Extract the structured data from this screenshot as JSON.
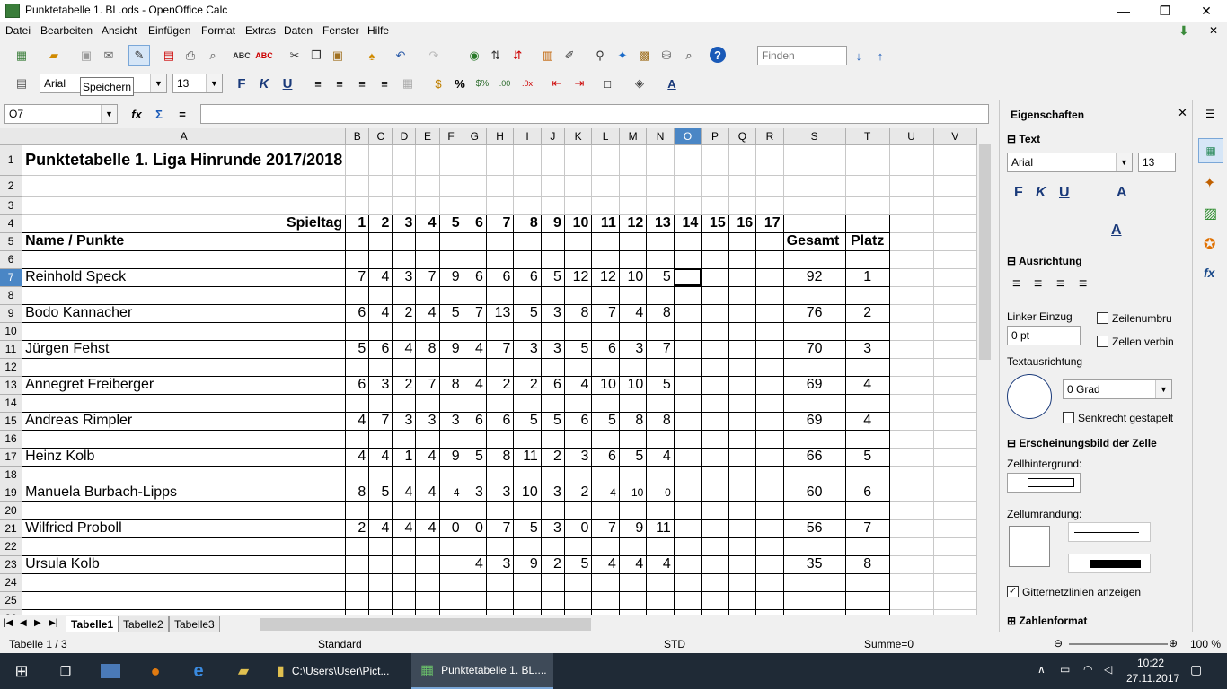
{
  "titlebar": {
    "title": "Punktetabelle 1. BL.ods - OpenOffice Calc",
    "minimize": "—",
    "restore": "❐",
    "close": "✕"
  },
  "menu": [
    "Datei",
    "Bearbeiten",
    "Ansicht",
    "Einfügen",
    "Format",
    "Extras",
    "Daten",
    "Fenster",
    "Hilfe"
  ],
  "toolbar": {
    "find_placeholder": "Finden",
    "font_name": "Arial",
    "font_size": "13",
    "tooltip": "Speichern"
  },
  "formula": {
    "cell_ref": "O7",
    "content": ""
  },
  "columns": [
    "A",
    "B",
    "C",
    "D",
    "E",
    "F",
    "G",
    "H",
    "I",
    "J",
    "K",
    "L",
    "M",
    "N",
    "O",
    "P",
    "Q",
    "R",
    "S",
    "T",
    "U",
    "V"
  ],
  "selected_column": "O",
  "selected_row": "7",
  "sheet": {
    "title": "Punktetabelle 1. Liga Hinrunde 2017/2018",
    "spieltag_label": "Spieltag",
    "spieltage": [
      "1",
      "2",
      "3",
      "4",
      "5",
      "6",
      "7",
      "8",
      "9",
      "10",
      "11",
      "12",
      "13",
      "14",
      "15",
      "16",
      "17"
    ],
    "name_header": "Name / Punkte",
    "gesamt_header": "Gesamt",
    "platz_header": "Platz",
    "players": [
      {
        "row": "7",
        "name": "Reinhold Speck",
        "scores": [
          "7",
          "4",
          "3",
          "7",
          "9",
          "6",
          "6",
          "6",
          "5",
          "12",
          "12",
          "10",
          "5"
        ],
        "gesamt": "92",
        "platz": "1"
      },
      {
        "row": "9",
        "name": "Bodo Kannacher",
        "scores": [
          "6",
          "4",
          "2",
          "4",
          "5",
          "7",
          "13",
          "5",
          "3",
          "8",
          "7",
          "4",
          "8"
        ],
        "gesamt": "76",
        "platz": "2"
      },
      {
        "row": "11",
        "name": "Jürgen Fehst",
        "scores": [
          "5",
          "6",
          "4",
          "8",
          "9",
          "4",
          "7",
          "3",
          "3",
          "5",
          "6",
          "3",
          "7"
        ],
        "gesamt": "70",
        "platz": "3"
      },
      {
        "row": "13",
        "name": "Annegret Freiberger",
        "scores": [
          "6",
          "3",
          "2",
          "7",
          "8",
          "4",
          "2",
          "2",
          "6",
          "4",
          "10",
          "10",
          "5"
        ],
        "gesamt": "69",
        "platz": "4"
      },
      {
        "row": "15",
        "name": "Andreas Rimpler",
        "scores": [
          "4",
          "7",
          "3",
          "3",
          "3",
          "6",
          "6",
          "5",
          "5",
          "6",
          "5",
          "8",
          "8"
        ],
        "gesamt": "69",
        "platz": "4"
      },
      {
        "row": "17",
        "name": "Heinz Kolb",
        "scores": [
          "4",
          "4",
          "1",
          "4",
          "9",
          "5",
          "8",
          "11",
          "2",
          "3",
          "6",
          "5",
          "4"
        ],
        "gesamt": "66",
        "platz": "5"
      },
      {
        "row": "19",
        "name": "Manuela Burbach-Lipps",
        "scores": [
          "8",
          "5",
          "4",
          "4",
          "4",
          "3",
          "3",
          "10",
          "3",
          "2",
          "4",
          "10",
          "0"
        ],
        "gesamt": "60",
        "platz": "6"
      },
      {
        "row": "21",
        "name": "Wilfried Proboll",
        "scores": [
          "2",
          "4",
          "4",
          "4",
          "0",
          "0",
          "7",
          "5",
          "3",
          "0",
          "7",
          "9",
          "11"
        ],
        "gesamt": "56",
        "platz": "7"
      },
      {
        "row": "23",
        "name": "Ursula Kolb",
        "scores": [
          "",
          "",
          "",
          "",
          "",
          "4",
          "3",
          "9",
          "2",
          "5",
          "4",
          "4",
          "4"
        ],
        "gesamt": "35",
        "platz": "8"
      }
    ]
  },
  "tabs": [
    "Tabelle1",
    "Tabelle2",
    "Tabelle3"
  ],
  "status": {
    "sheet": "Tabelle 1 / 3",
    "style": "Standard",
    "mode": "STD",
    "sum": "Summe=0",
    "zoom": "100 %"
  },
  "sidebar": {
    "title": "Eigenschaften",
    "text_section": "Text",
    "font": "Arial",
    "size": "13",
    "align_section": "Ausrichtung",
    "indent_label": "Linker Einzug",
    "indent_value": "0 pt",
    "wrap_label": "Zeilenumbru",
    "merge_label": "Zellen verbin",
    "orient_label": "Textausrichtung",
    "angle": "0 Grad",
    "stacked_label": "Senkrecht gestapelt",
    "appearance_section": "Erscheinungsbild der Zelle",
    "bg_label": "Zellhintergrund:",
    "border_label": "Zellumrandung:",
    "grid_label": "Gitternetzlinien anzeigen",
    "number_section": "Zahlenformat"
  },
  "taskbar": {
    "explorer": "C:\\Users\\User\\Pict...",
    "calc": "Punktetabelle 1. BL....",
    "time": "10:22",
    "date": "27.11.2017"
  }
}
